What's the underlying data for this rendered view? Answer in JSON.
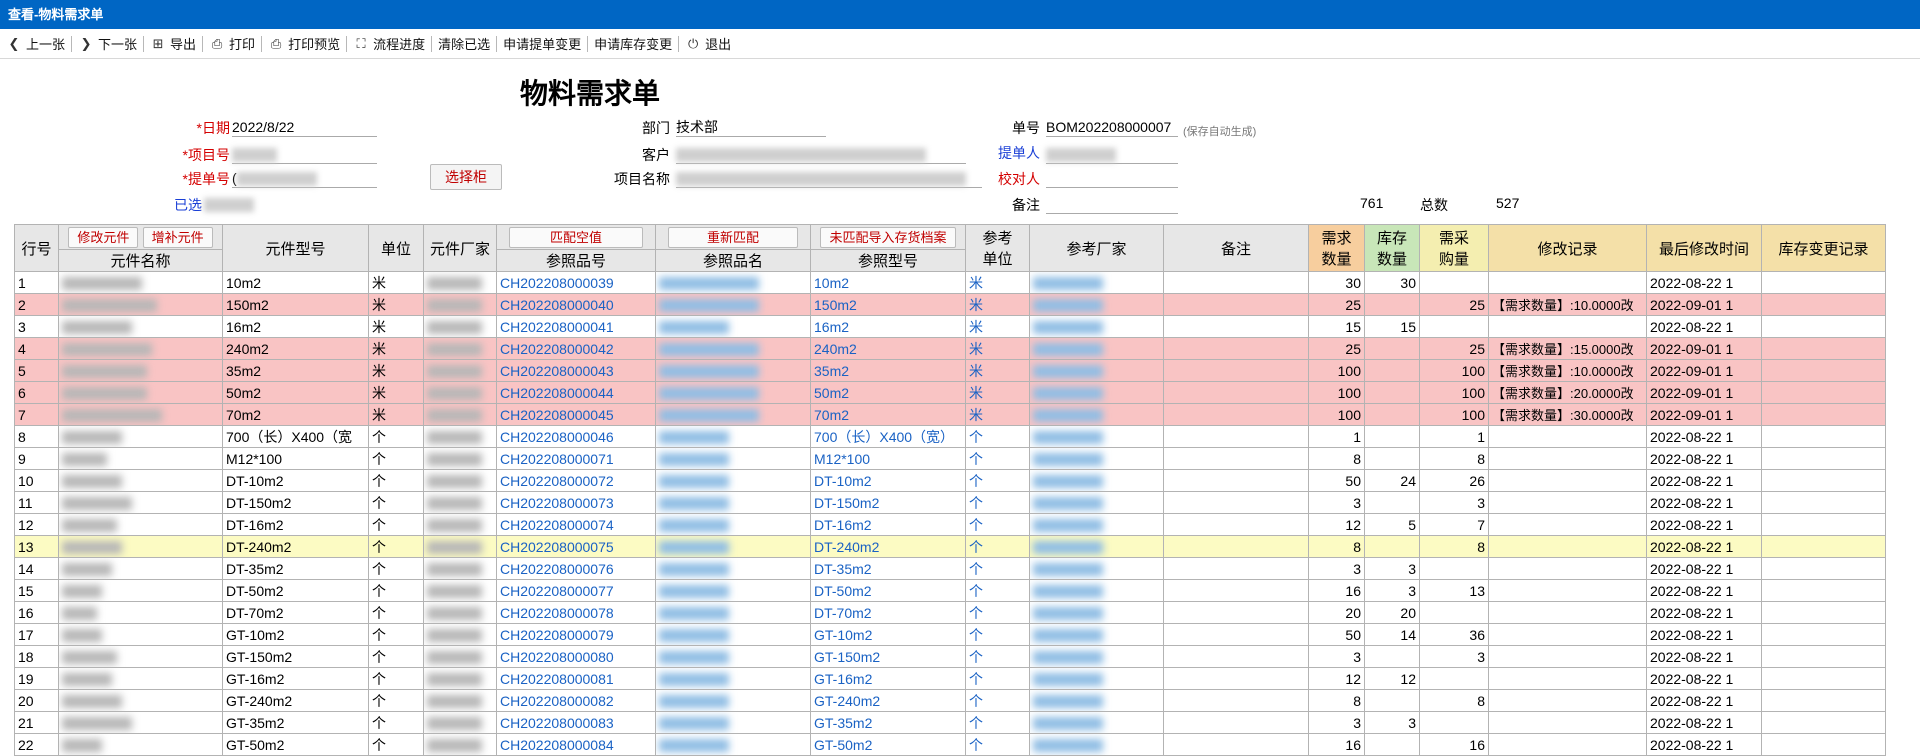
{
  "window": {
    "title": "查看-物料需求单"
  },
  "toolbar": [
    {
      "name": "prev-button",
      "icon": "chevron-left-icon",
      "glyph": "❮",
      "label": "上一张"
    },
    {
      "name": "next-button",
      "icon": "chevron-right-icon",
      "glyph": "❯",
      "label": "下一张"
    },
    {
      "name": "export-button",
      "icon": "export-icon",
      "glyph": "⊞",
      "label": "导出"
    },
    {
      "name": "print-button",
      "icon": "printer-icon",
      "glyph": "⎙",
      "label": "打印"
    },
    {
      "name": "print-preview-button",
      "icon": "print-preview-icon",
      "glyph": "⎙",
      "label": "打印预览"
    },
    {
      "name": "process-button",
      "icon": "flow-icon",
      "glyph": "⛶",
      "label": "流程进度"
    },
    {
      "name": "clear-button",
      "icon": "",
      "glyph": "",
      "label": "清除已选"
    },
    {
      "name": "change-order-button",
      "icon": "",
      "glyph": "",
      "label": "申请提单变更"
    },
    {
      "name": "change-stock-button",
      "icon": "",
      "glyph": "",
      "label": "申请库存变更"
    },
    {
      "name": "exit-button",
      "icon": "power-icon",
      "glyph": "⏻",
      "label": "退出"
    }
  ],
  "form": {
    "title": "物料需求单",
    "date_label": "*日期",
    "date_value": "2022/8/22",
    "project_no_label": "*项目号",
    "order_no_label": "*提单号",
    "order_no_prefix": "(",
    "selected_label": "已选",
    "pick_button": "选择柜",
    "dept_label": "部门",
    "dept_value": "技术部",
    "customer_label": "客户",
    "project_name_label": "项目名称",
    "doc_no_label": "单号",
    "doc_no_value": "BOM202208000007",
    "doc_no_hint": "(保存自动生成)",
    "requester_label": "提单人",
    "checker_label": "校对人",
    "remark_label": "备注",
    "count_left": "761",
    "total_label": "总数",
    "total_value": "527"
  },
  "table": {
    "headers": {
      "row_no": "行号",
      "name": "元件名称",
      "model": "元件型号",
      "unit": "单位",
      "maker": "元件厂家",
      "ref_code": "参照品号",
      "ref_name": "参照品名",
      "ref_model": "参照型号",
      "ref_unit_1": "参考",
      "ref_unit_2": "单位",
      "ref_maker": "参考厂家",
      "remark": "备注",
      "qty_1": "需求",
      "qty_2": "数量",
      "stk_1": "库存",
      "stk_2": "数量",
      "buy_1": "需采",
      "buy_2": "购量",
      "mod_log": "修改记录",
      "last_mod": "最后修改时间",
      "stock_log": "库存变更记录"
    },
    "buttons": {
      "edit": "修改元件",
      "add": "增补元件",
      "match_empty": "匹配空值",
      "rematch": "重新匹配",
      "import": "未匹配导入存货档案"
    },
    "rows": [
      {
        "no": "1",
        "model": "10m2",
        "unit": "米",
        "code": "CH202208000039",
        "rmodel": "10m2",
        "runit": "米",
        "qty": "30",
        "stk": "30",
        "buy": "",
        "log": "",
        "time": "2022-08-22 1",
        "hl": ""
      },
      {
        "no": "2",
        "model": "150m2",
        "unit": "米",
        "code": "CH202208000040",
        "rmodel": "150m2",
        "runit": "米",
        "qty": "25",
        "stk": "",
        "buy": "25",
        "log": "【需求数量】:10.0000改",
        "time": "2022-09-01 1",
        "hl": "red"
      },
      {
        "no": "3",
        "model": "16m2",
        "unit": "米",
        "code": "CH202208000041",
        "rmodel": "16m2",
        "runit": "米",
        "qty": "15",
        "stk": "15",
        "buy": "",
        "log": "",
        "time": "2022-08-22 1",
        "hl": ""
      },
      {
        "no": "4",
        "model": "240m2",
        "unit": "米",
        "code": "CH202208000042",
        "rmodel": "240m2",
        "runit": "米",
        "qty": "25",
        "stk": "",
        "buy": "25",
        "log": "【需求数量】:15.0000改",
        "time": "2022-09-01 1",
        "hl": "red"
      },
      {
        "no": "5",
        "model": "35m2",
        "unit": "米",
        "code": "CH202208000043",
        "rmodel": "35m2",
        "runit": "米",
        "qty": "100",
        "stk": "",
        "buy": "100",
        "log": "【需求数量】:10.0000改",
        "time": "2022-09-01 1",
        "hl": "red"
      },
      {
        "no": "6",
        "model": "50m2",
        "unit": "米",
        "code": "CH202208000044",
        "rmodel": "50m2",
        "runit": "米",
        "qty": "100",
        "stk": "",
        "buy": "100",
        "log": "【需求数量】:20.0000改",
        "time": "2022-09-01 1",
        "hl": "red"
      },
      {
        "no": "7",
        "model": "70m2",
        "unit": "米",
        "code": "CH202208000045",
        "rmodel": "70m2",
        "runit": "米",
        "qty": "100",
        "stk": "",
        "buy": "100",
        "log": "【需求数量】:30.0000改",
        "time": "2022-09-01 1",
        "hl": "red"
      },
      {
        "no": "8",
        "model": "700（长）X400（宽",
        "unit": "个",
        "code": "CH202208000046",
        "rmodel": "700（长）X400（宽）",
        "runit": "个",
        "qty": "1",
        "stk": "",
        "buy": "1",
        "log": "",
        "time": "2022-08-22 1",
        "hl": ""
      },
      {
        "no": "9",
        "model": "M12*100",
        "unit": "个",
        "code": "CH202208000071",
        "rmodel": "M12*100",
        "runit": "个",
        "qty": "8",
        "stk": "",
        "buy": "8",
        "log": "",
        "time": "2022-08-22 1",
        "hl": ""
      },
      {
        "no": "10",
        "model": "DT-10m2",
        "unit": "个",
        "code": "CH202208000072",
        "rmodel": "DT-10m2",
        "runit": "个",
        "qty": "50",
        "stk": "24",
        "buy": "26",
        "log": "",
        "time": "2022-08-22 1",
        "hl": ""
      },
      {
        "no": "11",
        "model": "DT-150m2",
        "unit": "个",
        "code": "CH202208000073",
        "rmodel": "DT-150m2",
        "runit": "个",
        "qty": "3",
        "stk": "",
        "buy": "3",
        "log": "",
        "time": "2022-08-22 1",
        "hl": ""
      },
      {
        "no": "12",
        "model": "DT-16m2",
        "unit": "个",
        "code": "CH202208000074",
        "rmodel": "DT-16m2",
        "runit": "个",
        "qty": "12",
        "stk": "5",
        "buy": "7",
        "log": "",
        "time": "2022-08-22 1",
        "hl": ""
      },
      {
        "no": "13",
        "model": "DT-240m2",
        "unit": "个",
        "code": "CH202208000075",
        "rmodel": "DT-240m2",
        "runit": "个",
        "qty": "8",
        "stk": "",
        "buy": "8",
        "log": "",
        "time": "2022-08-22 1",
        "hl": "yel"
      },
      {
        "no": "14",
        "model": "DT-35m2",
        "unit": "个",
        "code": "CH202208000076",
        "rmodel": "DT-35m2",
        "runit": "个",
        "qty": "3",
        "stk": "3",
        "buy": "",
        "log": "",
        "time": "2022-08-22 1",
        "hl": ""
      },
      {
        "no": "15",
        "model": "DT-50m2",
        "unit": "个",
        "code": "CH202208000077",
        "rmodel": "DT-50m2",
        "runit": "个",
        "qty": "16",
        "stk": "3",
        "buy": "13",
        "log": "",
        "time": "2022-08-22 1",
        "hl": ""
      },
      {
        "no": "16",
        "model": "DT-70m2",
        "unit": "个",
        "code": "CH202208000078",
        "rmodel": "DT-70m2",
        "runit": "个",
        "qty": "20",
        "stk": "20",
        "buy": "",
        "log": "",
        "time": "2022-08-22 1",
        "hl": ""
      },
      {
        "no": "17",
        "model": "GT-10m2",
        "unit": "个",
        "code": "CH202208000079",
        "rmodel": "GT-10m2",
        "runit": "个",
        "qty": "50",
        "stk": "14",
        "buy": "36",
        "log": "",
        "time": "2022-08-22 1",
        "hl": ""
      },
      {
        "no": "18",
        "model": "GT-150m2",
        "unit": "个",
        "code": "CH202208000080",
        "rmodel": "GT-150m2",
        "runit": "个",
        "qty": "3",
        "stk": "",
        "buy": "3",
        "log": "",
        "time": "2022-08-22 1",
        "hl": ""
      },
      {
        "no": "19",
        "model": "GT-16m2",
        "unit": "个",
        "code": "CH202208000081",
        "rmodel": "GT-16m2",
        "runit": "个",
        "qty": "12",
        "stk": "12",
        "buy": "",
        "log": "",
        "time": "2022-08-22 1",
        "hl": ""
      },
      {
        "no": "20",
        "model": "GT-240m2",
        "unit": "个",
        "code": "CH202208000082",
        "rmodel": "GT-240m2",
        "runit": "个",
        "qty": "8",
        "stk": "",
        "buy": "8",
        "log": "",
        "time": "2022-08-22 1",
        "hl": ""
      },
      {
        "no": "21",
        "model": "GT-35m2",
        "unit": "个",
        "code": "CH202208000083",
        "rmodel": "GT-35m2",
        "runit": "个",
        "qty": "3",
        "stk": "3",
        "buy": "",
        "log": "",
        "time": "2022-08-22 1",
        "hl": ""
      },
      {
        "no": "22",
        "model": "GT-50m2",
        "unit": "个",
        "code": "CH202208000084",
        "rmodel": "GT-50m2",
        "runit": "个",
        "qty": "16",
        "stk": "",
        "buy": "16",
        "log": "",
        "time": "2022-08-22 1",
        "hl": ""
      }
    ]
  },
  "colors": {
    "titlebar": "#0066c4",
    "row_red": "#f9c4c4",
    "row_yellow": "#fcfbc3",
    "link": "#1a62c4"
  }
}
